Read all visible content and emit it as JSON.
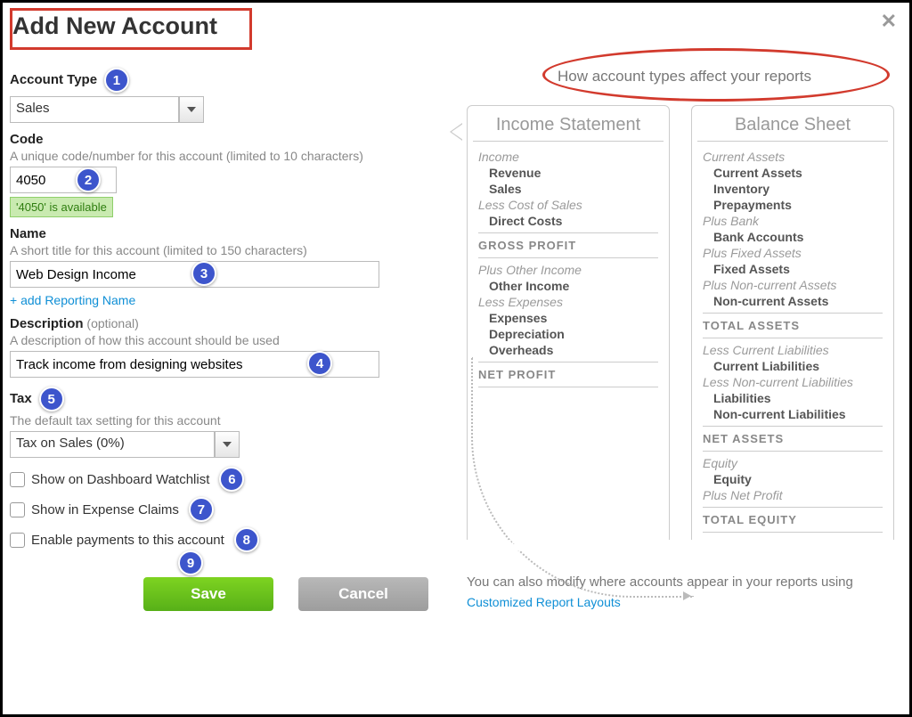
{
  "dialog": {
    "title": "Add New Account"
  },
  "form": {
    "account_type": {
      "label": "Account Type",
      "value": "Sales"
    },
    "code": {
      "label": "Code",
      "hint": "A unique code/number for this account (limited to 10 characters)",
      "value": "4050",
      "availability": "'4050' is available"
    },
    "name": {
      "label": "Name",
      "hint": "A short title for this account (limited to 150 characters)",
      "value": "Web Design Income",
      "add_reporting_link": "+ add Reporting Name"
    },
    "description": {
      "label": "Description",
      "optional": "(optional)",
      "hint": "A description of how this account should be used",
      "value": "Track income from designing websites"
    },
    "tax": {
      "label": "Tax",
      "hint": "The default tax setting for this account",
      "value": "Tax on Sales (0%)"
    },
    "checkboxes": {
      "watchlist": "Show on Dashboard Watchlist",
      "expense": "Show in Expense Claims",
      "payments": "Enable payments to this account"
    },
    "buttons": {
      "save": "Save",
      "cancel": "Cancel"
    }
  },
  "markers": {
    "m1": "1",
    "m2": "2",
    "m3": "3",
    "m4": "4",
    "m5": "5",
    "m6": "6",
    "m7": "7",
    "m8": "8",
    "m9": "9"
  },
  "info": {
    "title": "How account types affect your reports",
    "income_statement": {
      "title": "Income Statement",
      "income_cat": "Income",
      "revenue": "Revenue",
      "sales": "Sales",
      "less_cos": "Less Cost of Sales",
      "direct_costs": "Direct Costs",
      "gross_profit": "GROSS PROFIT",
      "plus_other": "Plus Other Income",
      "other_income": "Other Income",
      "less_exp": "Less Expenses",
      "expenses": "Expenses",
      "depreciation": "Depreciation",
      "overheads": "Overheads",
      "net_profit": "NET PROFIT"
    },
    "balance_sheet": {
      "title": "Balance Sheet",
      "current_assets_cat": "Current Assets",
      "current_assets": "Current Assets",
      "inventory": "Inventory",
      "prepayments": "Prepayments",
      "plus_bank": "Plus Bank",
      "bank_accounts": "Bank Accounts",
      "plus_fixed": "Plus Fixed Assets",
      "fixed_assets": "Fixed Assets",
      "plus_nca": "Plus Non-current Assets",
      "nca": "Non-current Assets",
      "total_assets": "TOTAL ASSETS",
      "less_cl": "Less Current Liabilities",
      "cl": "Current Liabilities",
      "less_ncl": "Less Non-current Liabilities",
      "liab": "Liabilities",
      "ncl": "Non-current Liabilities",
      "net_assets": "NET ASSETS",
      "equity_cat": "Equity",
      "equity": "Equity",
      "plus_np": "Plus Net Profit",
      "total_equity": "TOTAL EQUITY"
    },
    "footnote_pre": "You can also modify where accounts appear in your reports using ",
    "footnote_link": "Customized Report Layouts"
  }
}
